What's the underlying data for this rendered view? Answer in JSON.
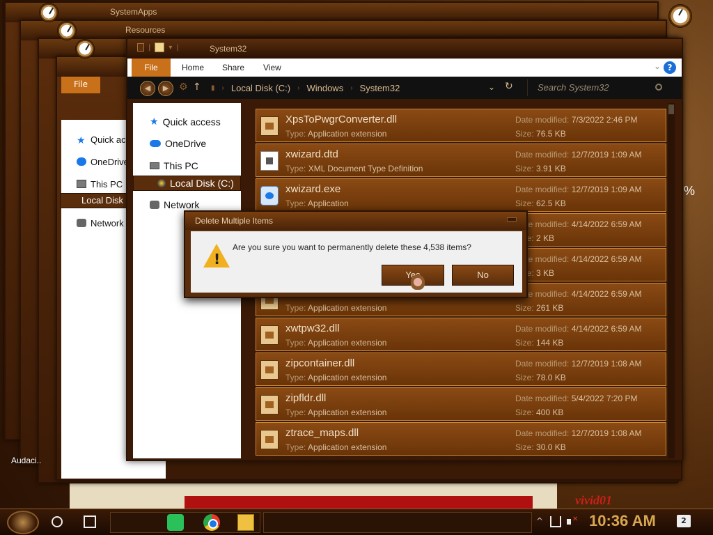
{
  "background_windows": [
    {
      "title": "SystemApps"
    },
    {
      "title": "Resources"
    }
  ],
  "main_window": {
    "title": "System32",
    "ribbon": {
      "file_label": "File",
      "tabs": [
        "Home",
        "Share",
        "View"
      ],
      "help": "?"
    },
    "address": {
      "crumbs": [
        "Local Disk (C:)",
        "Windows",
        "System32"
      ],
      "search_placeholder": "Search System32"
    },
    "nav": {
      "items": [
        {
          "label": "Quick access",
          "icon": "star-icon"
        },
        {
          "label": "OneDrive",
          "icon": "cloud-icon"
        },
        {
          "label": "This PC",
          "icon": "pc-icon"
        },
        {
          "label": "Local Disk (C:)",
          "icon": "disk-icon",
          "selected": true
        },
        {
          "label": "Network",
          "icon": "network-icon"
        }
      ]
    },
    "file_labels": {
      "type": "Type:",
      "date": "Date modified:",
      "size": "Size:"
    },
    "files": [
      {
        "name": "XpsToPwgrConverter.dll",
        "type": "Application extension",
        "date": "7/3/2022 2:46 PM",
        "size": "76.5 KB"
      },
      {
        "name": "xwizard.dtd",
        "type": "XML Document Type Definition",
        "date": "12/7/2019 1:09 AM",
        "size": "3.91 KB"
      },
      {
        "name": "xwizard.exe",
        "type": "Application",
        "date": "12/7/2019 1:09 AM",
        "size": "62.5 KB"
      },
      {
        "name": "",
        "type": "",
        "date": "4/14/2022 6:59 AM",
        "size": "2 KB"
      },
      {
        "name": "",
        "type": "",
        "date": "4/14/2022 6:59 AM",
        "size": "3 KB"
      },
      {
        "name": "",
        "type": "Application extension",
        "date": "4/14/2022 6:59 AM",
        "size": "261 KB"
      },
      {
        "name": "xwtpw32.dll",
        "type": "Application extension",
        "date": "4/14/2022 6:59 AM",
        "size": "144 KB"
      },
      {
        "name": "zipcontainer.dll",
        "type": "Application extension",
        "date": "12/7/2019 1:08 AM",
        "size": "78.0 KB"
      },
      {
        "name": "zipfldr.dll",
        "type": "Application extension",
        "date": "5/4/2022 7:20 PM",
        "size": "400 KB"
      },
      {
        "name": "ztrace_maps.dll",
        "type": "Application extension",
        "date": "12/7/2019 1:08 AM",
        "size": "30.0 KB"
      }
    ]
  },
  "bg_nav": {
    "quick_access": "Quick access",
    "onedrive": "OneDrive",
    "this_pc": "This PC",
    "local_disk": "Local Disk (C:)",
    "network": "Network",
    "file_label": "File"
  },
  "dialog": {
    "title": "Delete Multiple Items",
    "message": "Are you sure you want to permanently delete these 4,538 items?",
    "yes_label": "Yes",
    "no_label": "No"
  },
  "desktop": {
    "audacity_label": "Audaci..",
    "percent_label": "%",
    "brand_label": "vivid01"
  },
  "taskbar": {
    "clock": "10:36 AM",
    "notification_count": "2"
  }
}
